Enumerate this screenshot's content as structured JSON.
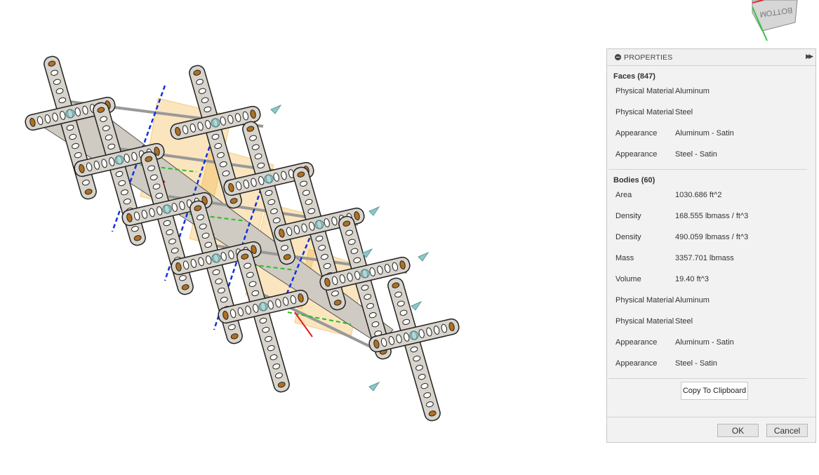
{
  "viewcube": {
    "face_label": "BOTTOM"
  },
  "panel": {
    "title": "PROPERTIES",
    "faces": {
      "title": "Faces (847)",
      "rows": [
        {
          "k": "Physical Material",
          "v": "Aluminum"
        },
        {
          "k": "Physical Material",
          "v": "Steel"
        },
        {
          "k": "Appearance",
          "v": "Aluminum - Satin"
        },
        {
          "k": "Appearance",
          "v": "Steel - Satin"
        }
      ]
    },
    "bodies": {
      "title": "Bodies (60)",
      "rows": [
        {
          "k": "Area",
          "v": "1030.686 ft^2"
        },
        {
          "k": "Density",
          "v": "168.555 lbmass / ft^3"
        },
        {
          "k": "Density",
          "v": "490.059 lbmass / ft^3"
        },
        {
          "k": "Mass",
          "v": "3357.701 lbmass"
        },
        {
          "k": "Volume",
          "v": "19.40 ft^3"
        },
        {
          "k": "Physical Material",
          "v": "Aluminum"
        },
        {
          "k": "Physical Material",
          "v": "Steel"
        },
        {
          "k": "Appearance",
          "v": "Aluminum - Satin"
        },
        {
          "k": "Appearance",
          "v": "Steel - Satin"
        }
      ]
    },
    "copy_label": "Copy To Clipboard",
    "ok_label": "OK",
    "cancel_label": "Cancel"
  },
  "colors": {
    "plate_fill": "#d8d4cc",
    "plate_stroke": "#222222",
    "highlight": "#f2b544",
    "axis_red": "#e02020",
    "axis_green": "#20c020",
    "axis_blue": "#1030e0"
  }
}
